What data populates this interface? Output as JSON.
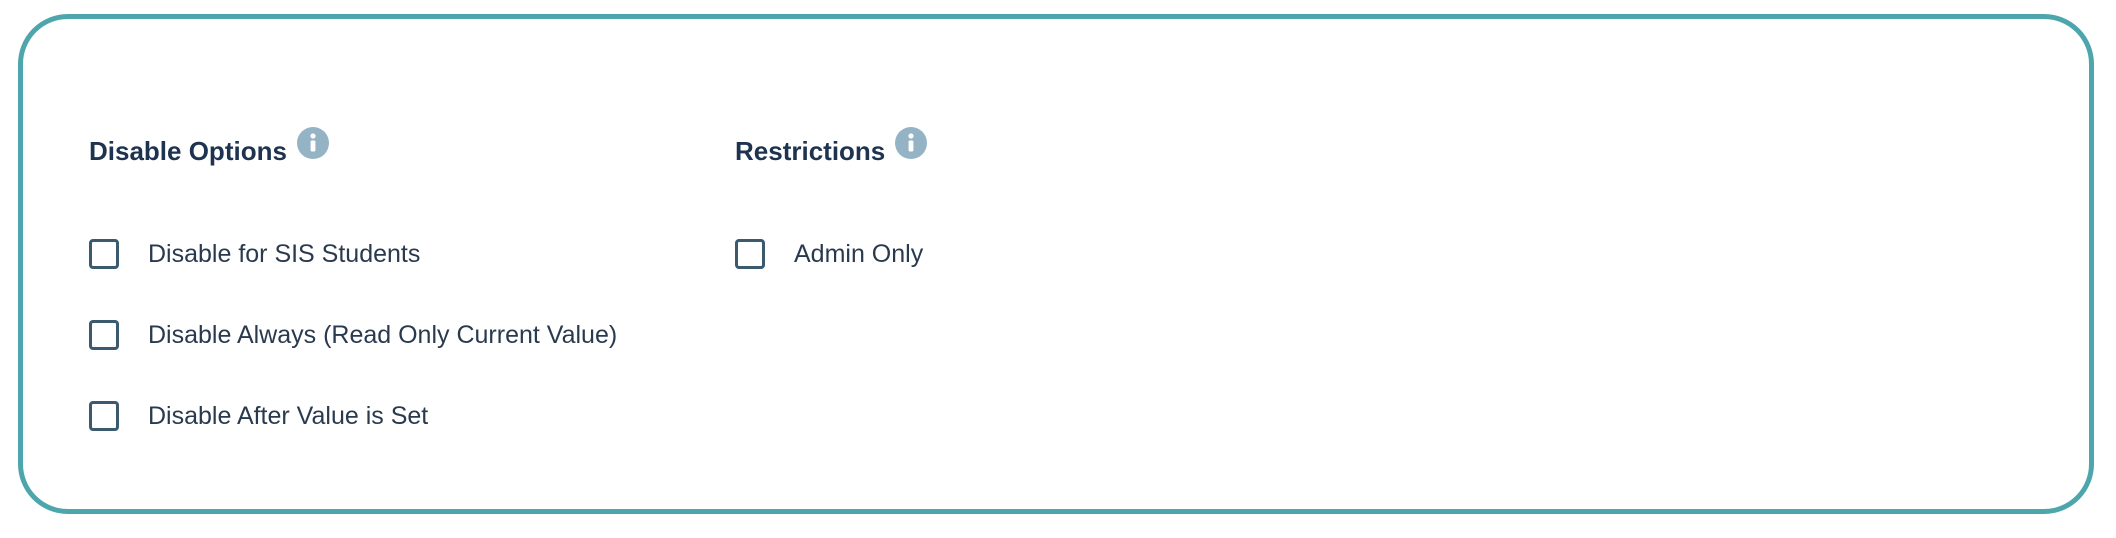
{
  "colors": {
    "panel_border": "#4ea6ad",
    "heading": "#1e3350",
    "info_icon": "#94b3c5",
    "checkbox_border": "#3c5a6e",
    "label_text": "#2a3a4e"
  },
  "disable_options": {
    "title": "Disable Options",
    "info_icon": "info-icon",
    "options": [
      {
        "label": "Disable for SIS Students",
        "checked": false
      },
      {
        "label": "Disable Always (Read Only Current Value)",
        "checked": false
      },
      {
        "label": "Disable After Value is Set",
        "checked": false
      }
    ]
  },
  "restrictions": {
    "title": "Restrictions",
    "info_icon": "info-icon",
    "options": [
      {
        "label": "Admin Only",
        "checked": false
      }
    ]
  }
}
